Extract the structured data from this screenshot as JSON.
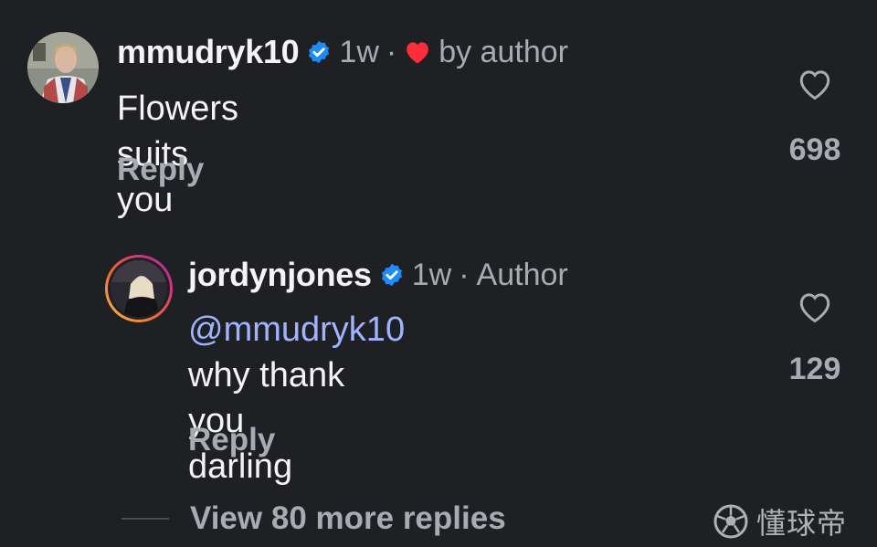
{
  "comments": [
    {
      "username": "mmudryk10",
      "verified": true,
      "time": "1w",
      "liked_by": "by author",
      "text": "Flowers suits you",
      "reply_label": "Reply",
      "like_count": "698"
    },
    {
      "username": "jordynjones",
      "verified": true,
      "time": "1w",
      "role": "Author",
      "mention": "@mmudryk10",
      "text_line1": "why thank you",
      "text_line2": "darling",
      "reply_label": "Reply",
      "like_count": "129"
    }
  ],
  "view_more": "View 80 more replies",
  "watermark": "懂球帝",
  "colors": {
    "background": "#1f2024",
    "muted": "#a8abb2",
    "mention": "#9fb3ff",
    "verified": "#1d8cf8",
    "heart": "#ff2d3c"
  }
}
